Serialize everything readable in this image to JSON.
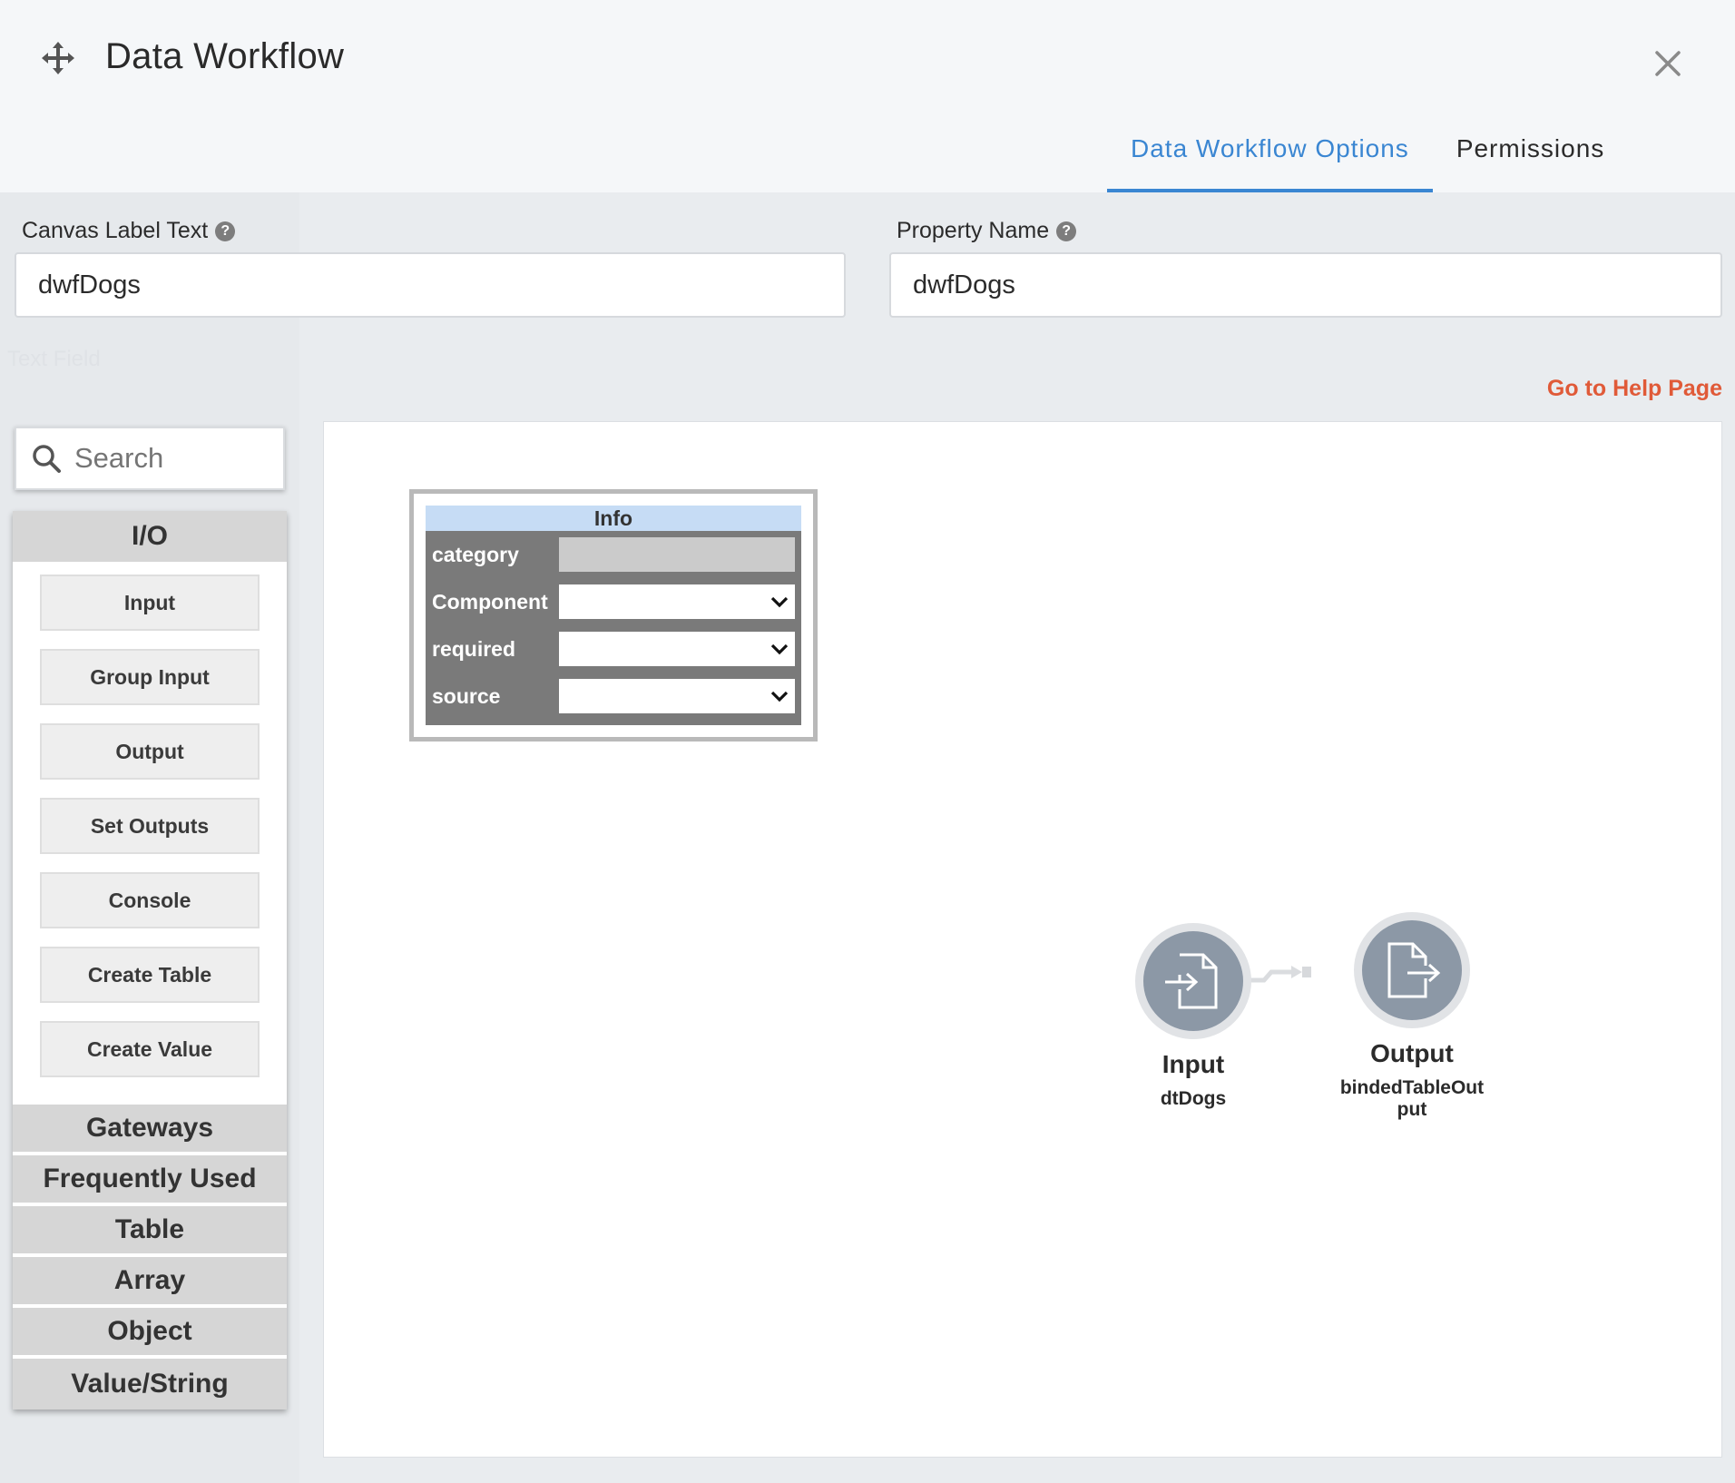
{
  "header": {
    "title": "Data Workflow",
    "tabs": [
      {
        "label": "Data Workflow Options",
        "active": true
      },
      {
        "label": "Permissions",
        "active": false
      }
    ]
  },
  "fields": {
    "canvas_label": {
      "label": "Canvas Label Text",
      "value": "dwfDogs"
    },
    "property_name": {
      "label": "Property Name",
      "value": "dwfDogs"
    }
  },
  "help_link": "Go to Help Page",
  "background": {
    "ghost_text": "Text Field"
  },
  "sidebar": {
    "search_placeholder": "Search",
    "categories": {
      "io": {
        "label": "I/O",
        "items": [
          "Input",
          "Group Input",
          "Output",
          "Set Outputs",
          "Console",
          "Create Table",
          "Create Value"
        ]
      },
      "collapsed": [
        "Gateways",
        "Frequently Used",
        "Table",
        "Array",
        "Object",
        "Value/String"
      ]
    }
  },
  "canvas": {
    "info_node": {
      "title": "Info",
      "rows": [
        {
          "label": "category",
          "kind": "text"
        },
        {
          "label": "Component",
          "kind": "select"
        },
        {
          "label": "required",
          "kind": "select"
        },
        {
          "label": "source",
          "kind": "select"
        }
      ]
    },
    "input_node": {
      "type": "Input",
      "name": "dtDogs"
    },
    "output_node": {
      "type": "Output",
      "name": "bindedTableOut put"
    }
  },
  "colors": {
    "accent": "#3a86d2",
    "help_link": "#e05a38",
    "node_circle": "#8c98a6",
    "info_title_bg": "#c6dcf5"
  }
}
